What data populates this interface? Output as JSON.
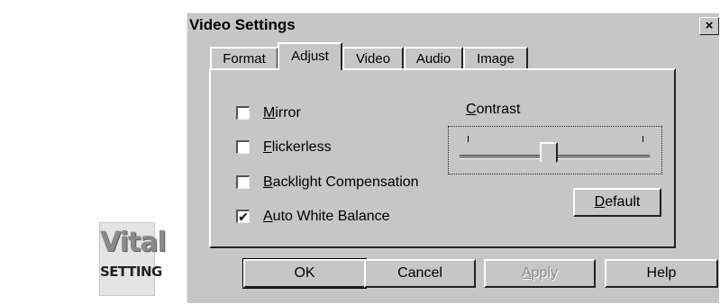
{
  "logo": {
    "line1": "Vital",
    "line2": "SETTING"
  },
  "window": {
    "title": "Video Settings",
    "close_label": "×"
  },
  "tabs": [
    {
      "label": "Format",
      "active": false
    },
    {
      "label": "Adjust",
      "active": true
    },
    {
      "label": "Video",
      "active": false
    },
    {
      "label": "Audio",
      "active": false
    },
    {
      "label": "Image",
      "active": false
    }
  ],
  "options": [
    {
      "label_first": "M",
      "label_rest": "irror",
      "checked": false,
      "mark": ""
    },
    {
      "label_first": "F",
      "label_rest": "lickerless",
      "checked": false,
      "mark": ""
    },
    {
      "label_first": "B",
      "label_rest": "acklight Compensation",
      "checked": false,
      "mark": ""
    },
    {
      "label_first": "A",
      "label_rest": "uto White Balance",
      "checked": true,
      "mark": "✔"
    }
  ],
  "contrast": {
    "label_first": "C",
    "label_rest": "ontrast",
    "value": 0.47
  },
  "default_button": {
    "label_first": "D",
    "label_rest": "efault"
  },
  "buttons": {
    "ok": "OK",
    "cancel": "Cancel",
    "apply_first": "A",
    "apply_rest": "pply",
    "help": "Help"
  }
}
